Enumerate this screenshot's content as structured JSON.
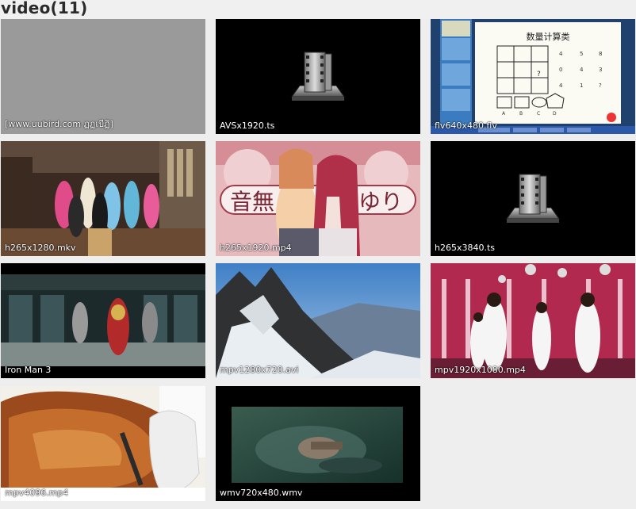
{
  "header": {
    "title": "video(11)"
  },
  "videos": [
    {
      "name": "[www.uubird.com ฏฏเบีฏิ]"
    },
    {
      "name": "AVSx1920.ts"
    },
    {
      "name": "flv640x480.flv"
    },
    {
      "name": "h265x1280.mkv"
    },
    {
      "name": "h265x1920.mp4"
    },
    {
      "name": "h265x3840.ts"
    },
    {
      "name": "Iron Man 3"
    },
    {
      "name": "mpv1280x720.avi"
    },
    {
      "name": "mpv1920x1080.mp4"
    },
    {
      "name": "mpv4096.mp4"
    },
    {
      "name": "wmv720x480.wmv"
    }
  ],
  "slide": {
    "title": "数量计算类",
    "numbers": [
      "4",
      "5",
      "8",
      "0",
      "4",
      "3",
      "4",
      "1",
      "?"
    ],
    "options": [
      "A",
      "B",
      "C",
      "D"
    ],
    "qmark": "?"
  },
  "anime_text": {
    "left": "音無",
    "right": "ゆり"
  },
  "colors": {
    "background": "#eeeeee",
    "title": "#2a2a2a",
    "caption": "#ffffff"
  },
  "icons": {
    "generic_video": "film-reel-icon"
  }
}
